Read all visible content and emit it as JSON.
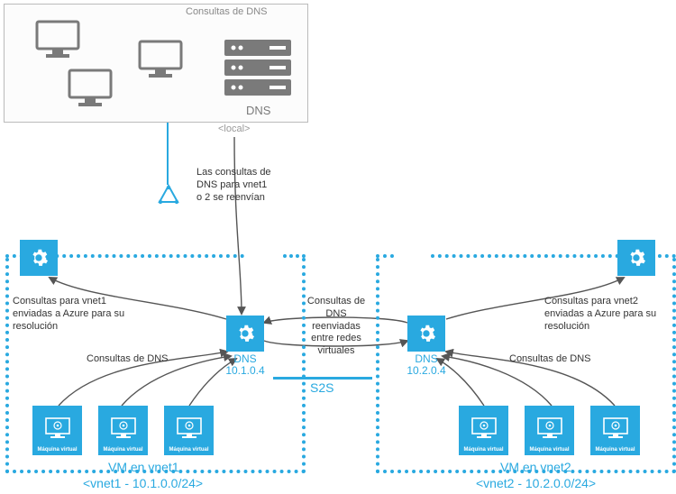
{
  "onprem": {
    "dns_label": "DNS",
    "local_tag": "<local>",
    "query_label": "Consultas de DNS"
  },
  "flow": {
    "forward_to_azure": "Las consultas de\nDNS para vnet1\no 2 se reenvían",
    "intervnet": "Consultas de\nDNS reenviadas\nentre redes\nvirtuales",
    "s2s": "S2S"
  },
  "vnet1": {
    "resolve": "Consultas para vnet1\nenviadas a Azure para su\nresolución",
    "dns_query": "Consultas de DNS",
    "dns_label": "DNS",
    "dns_ip": "10.1.0.4",
    "title": "VM en vnet1",
    "cidr": "<vnet1 - 10.1.0.0/24>",
    "vm_caption": "Máquina virtual"
  },
  "vnet2": {
    "resolve": "Consultas para vnet2\nenviadas a Azure para su\nresolución",
    "dns_query": "Consultas de DNS",
    "dns_label": "DNS",
    "dns_ip": "10.2.0.4",
    "title": "VM en vnet2",
    "cidr": "<vnet2 - 10.2.0.0/24>",
    "vm_caption": "Máquina virtual"
  },
  "colors": {
    "azure": "#29a9e0",
    "gray": "#7a7a7a"
  }
}
